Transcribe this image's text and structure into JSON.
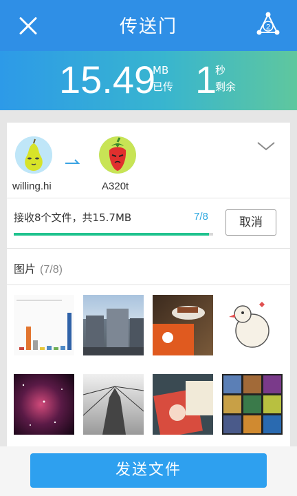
{
  "header": {
    "title": "传送门",
    "share_badge": "2"
  },
  "stats": {
    "size_value": "15.49",
    "size_unit": "MB",
    "size_label": "已传",
    "time_value": "1",
    "time_unit": "秒",
    "time_label": "剩余"
  },
  "transfer": {
    "sender_name": "willing.hi",
    "receiver_name": "A320t",
    "status_text": "接收8个文件，共15.7MB",
    "count_text": "7/8",
    "cancel_label": "取消",
    "progress": 0.98
  },
  "gallery": {
    "section_title": "图片",
    "section_count": "(7/8)",
    "items": [
      {
        "name": "chart-screenshot",
        "icon": "bar-chart"
      },
      {
        "name": "city-buildings",
        "icon": "building"
      },
      {
        "name": "cafe-dessert",
        "icon": "cake"
      },
      {
        "name": "cartoon-bird",
        "icon": "bird"
      },
      {
        "name": "galaxy",
        "icon": "stars"
      },
      {
        "name": "stupa-bw",
        "icon": "stupa"
      },
      {
        "name": "magazine",
        "icon": "book"
      },
      {
        "name": "photo-grid",
        "icon": "grid"
      }
    ]
  },
  "bottom": {
    "send_label": "发送文件"
  },
  "colors": {
    "header": "#2f8fe6",
    "accent": "#2ea0ef",
    "progress": "#1fc28e",
    "count": "#2fa8e0"
  }
}
